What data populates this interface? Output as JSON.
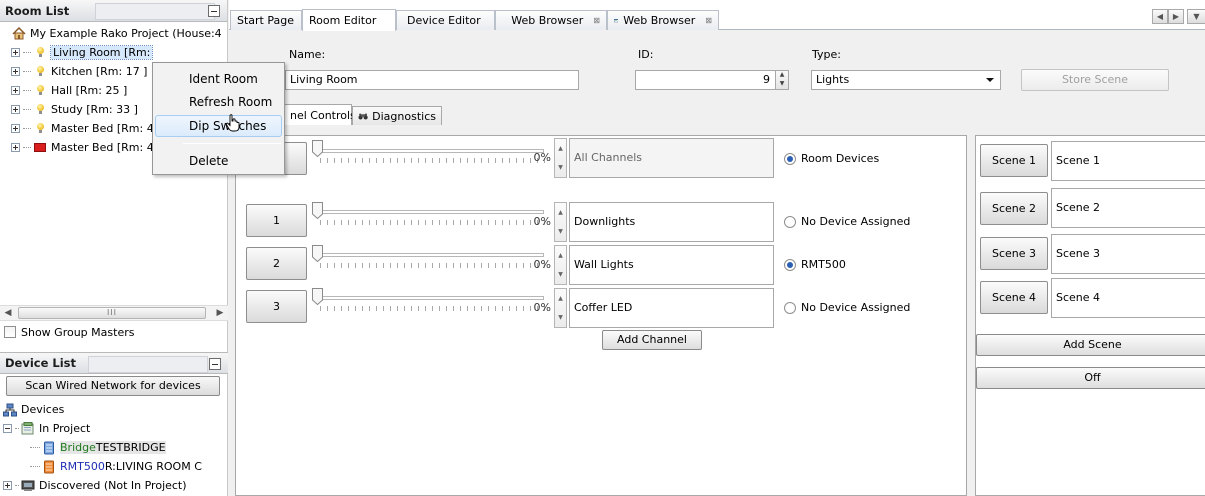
{
  "room_list": {
    "header": "Room List",
    "project": "My Example Rako Project (House:4",
    "rooms": [
      {
        "label": "Living Room [Rm: ",
        "icon": "bulb-icon"
      },
      {
        "label": "Kitchen  [Rm: 17 ]",
        "icon": "bulb-icon"
      },
      {
        "label": "Hall  [Rm: 25 ]",
        "icon": "bulb-icon"
      },
      {
        "label": "Study  [Rm: 33 ]",
        "icon": "bulb-icon"
      },
      {
        "label": "Master Bed [Rm: 4",
        "icon": "bulb-icon"
      },
      {
        "label": "Master Bed [Rm: 4",
        "icon": "red-block-icon"
      }
    ],
    "scroll_grip": "III",
    "show_group_masters": "Show Group Masters"
  },
  "device_list": {
    "header": "Device List",
    "scan_button": "Scan Wired Network for devices",
    "root": "Devices",
    "in_project": "In Project",
    "bridge": {
      "type": "Bridge",
      "name": " TESTBRIDGE"
    },
    "rmt": {
      "type": "RMT500",
      "name": " R:LIVING ROOM C"
    },
    "discovered": "Discovered (Not In Project)"
  },
  "context_menu": {
    "items": [
      "Ident Room",
      "Refresh Room",
      "Dip Switches",
      "Delete"
    ],
    "hovered": "Dip Switches"
  },
  "tabs": [
    {
      "label": "Start Page",
      "closable": true
    },
    {
      "label": "Room Editor",
      "closable": false,
      "active": true
    },
    {
      "label": "Device Editor",
      "closable": false
    },
    {
      "label": "Web Browser",
      "closable": true
    },
    {
      "label": "Web Browser",
      "closable": true
    }
  ],
  "tab_close_glyph": "⊠",
  "room_editor": {
    "name_label": "Name:",
    "name_value": "Living Room",
    "id_label": "ID:",
    "id_value": "9",
    "type_label": "Type:",
    "type_value": "Lights",
    "store_scene": "Store Scene",
    "subtabs": [
      "nel Controls",
      "Diagnostics"
    ],
    "master": {
      "percent": "0%",
      "name": "All Channels",
      "radio": "Room Devices",
      "radio_on": true
    },
    "channels": [
      {
        "number": "1",
        "percent": "0%",
        "name": "Downlights",
        "radio": "No Device Assigned",
        "radio_on": false
      },
      {
        "number": "2",
        "percent": "0%",
        "name": "Wall Lights",
        "radio": "RMT500",
        "radio_on": true
      },
      {
        "number": "3",
        "percent": "0%",
        "name": "Coffer LED",
        "radio": "No Device Assigned",
        "radio_on": false
      }
    ],
    "add_channel": "Add Channel",
    "scenes": [
      {
        "button": "Scene 1",
        "name": "Scene 1"
      },
      {
        "button": "Scene 2",
        "name": "Scene 2"
      },
      {
        "button": "Scene 3",
        "name": "Scene 3"
      },
      {
        "button": "Scene 4",
        "name": "Scene 4"
      }
    ],
    "add_scene": "Add Scene",
    "off": "Off"
  },
  "colors": {
    "bridge": "#1f7a1f",
    "rmt": "#1f2fb4",
    "radio_on": "#2b5fb4"
  }
}
